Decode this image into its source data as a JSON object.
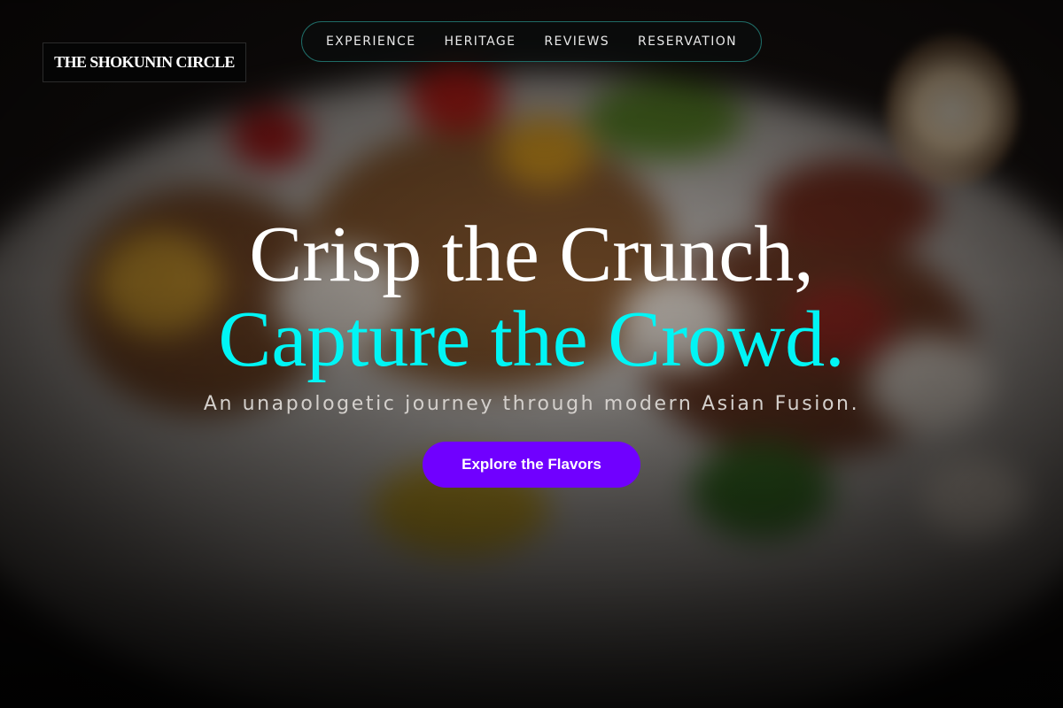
{
  "brand": {
    "logo_text": "THE SHOKUNIN CIRCLE"
  },
  "nav": {
    "items": [
      {
        "label": "EXPERIENCE"
      },
      {
        "label": "HERITAGE"
      },
      {
        "label": "REVIEWS"
      },
      {
        "label": "RESERVATION"
      }
    ]
  },
  "hero": {
    "headline_line1": "Crisp the Crunch,",
    "headline_line2": "Capture the Crowd.",
    "subtitle": "An unapologetic journey through modern Asian Fusion.",
    "cta_label": "Explore the Flavors",
    "background_image": "blurred-stir-fry-dish-photo"
  },
  "colors": {
    "accent": "#00f5f5",
    "cta": "#7000ff",
    "nav_border": "#1f6b66"
  }
}
